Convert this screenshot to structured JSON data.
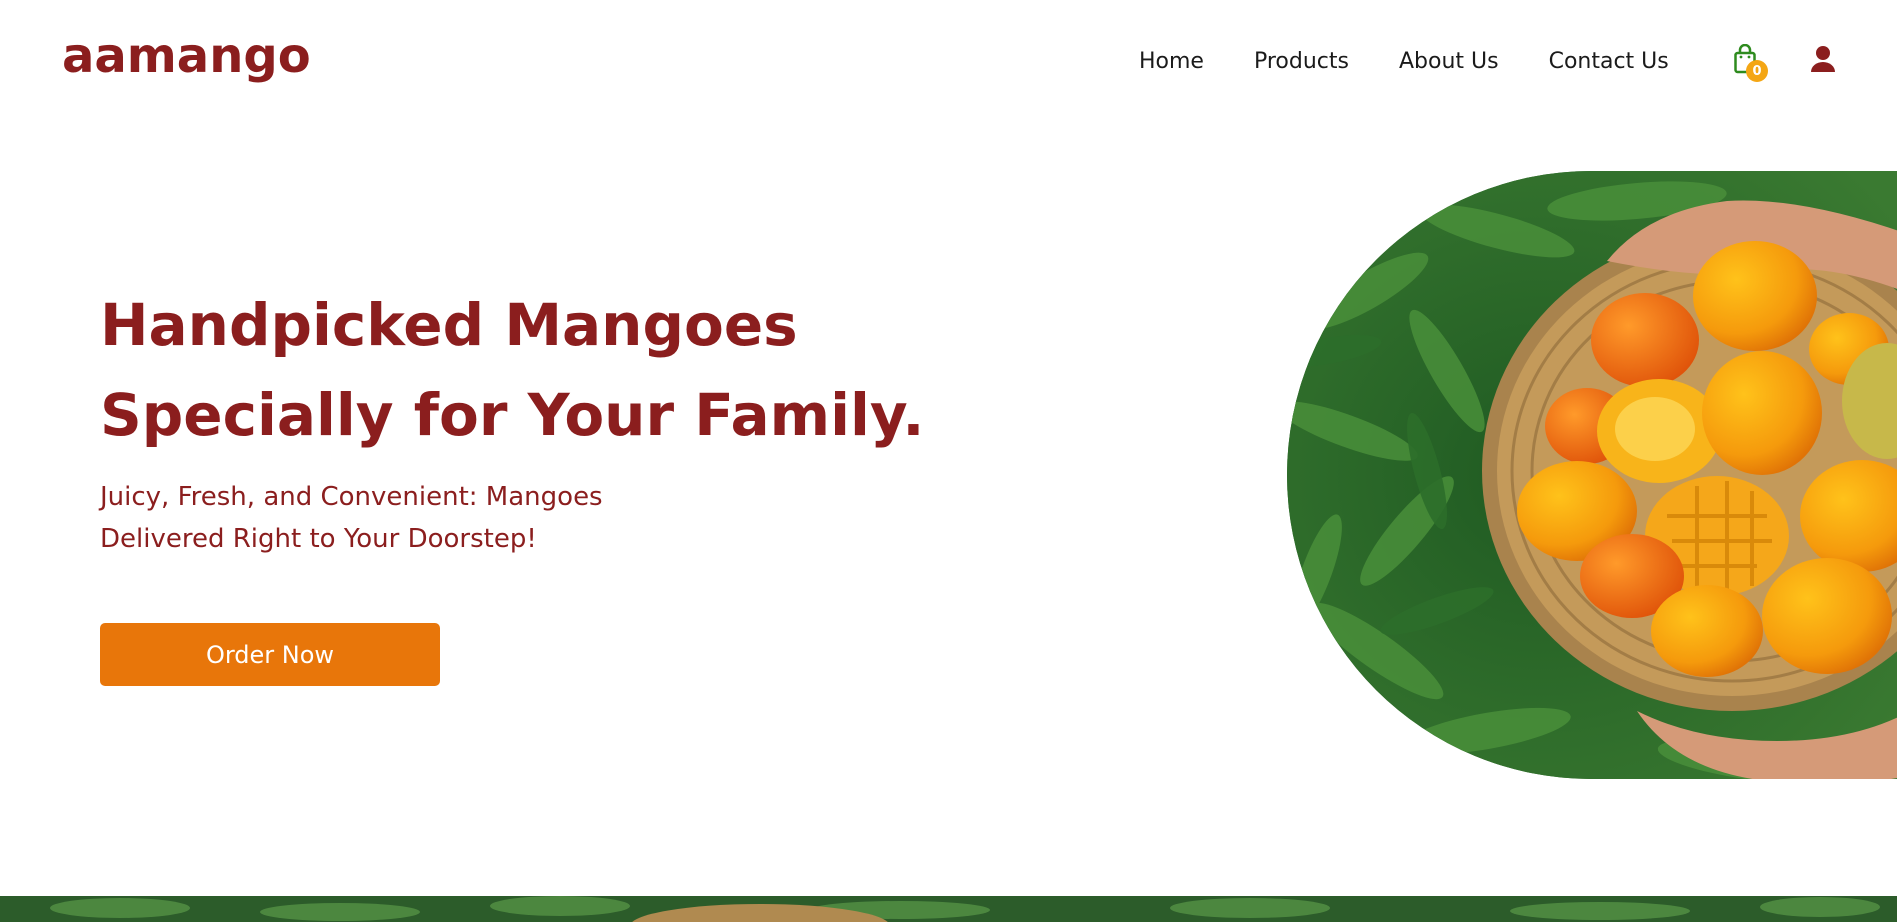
{
  "brand": {
    "logo_text": "aamango",
    "color": "#8b1e1e"
  },
  "nav": {
    "items": [
      {
        "label": "Home"
      },
      {
        "label": "Products"
      },
      {
        "label": "About Us"
      },
      {
        "label": "Contact Us"
      }
    ],
    "cart": {
      "icon": "shopping-bag-icon",
      "count": "0",
      "icon_color": "#2e8b1e",
      "badge_color": "#f4a614"
    },
    "user": {
      "icon": "user-icon",
      "color": "#8b1e1e"
    }
  },
  "hero": {
    "title_line1": "Handpicked Mangoes",
    "title_line2": "Specially for Your Family.",
    "subtitle_line1": "Juicy, Fresh, and Convenient: Mangoes",
    "subtitle_line2": "Delivered Right to Your Doorstep!",
    "cta_label": "Order Now",
    "cta_color": "#e8760a",
    "image": "mango-basket-photo"
  }
}
